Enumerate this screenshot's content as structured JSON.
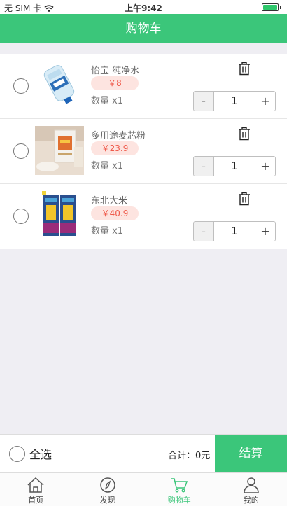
{
  "status_bar": {
    "carrier": "无 SIM 卡",
    "time": "上午9:42"
  },
  "nav": {
    "title": "购物车"
  },
  "colors": {
    "accent": "#3bc67a",
    "price_text": "#ef5a4b",
    "price_bg": "#fde4e0"
  },
  "items": [
    {
      "name": "怡宝 纯净水",
      "price": "￥8",
      "qty_label": "数量 x1",
      "qty": "1",
      "minus": "-",
      "plus": "+"
    },
    {
      "name": "多用途麦芯粉",
      "price": "￥23.9",
      "qty_label": "数量 x1",
      "qty": "1",
      "minus": "-",
      "plus": "+"
    },
    {
      "name": "东北大米",
      "price": "￥40.9",
      "qty_label": "数量 x1",
      "qty": "1",
      "minus": "-",
      "plus": "+"
    }
  ],
  "footer": {
    "select_all": "全选",
    "total": "合计：0元",
    "checkout": "结算"
  },
  "tabs": [
    {
      "label": "首页",
      "icon": "home-icon"
    },
    {
      "label": "发现",
      "icon": "compass-icon"
    },
    {
      "label": "购物车",
      "icon": "cart-icon",
      "active": true
    },
    {
      "label": "我的",
      "icon": "user-icon"
    }
  ]
}
